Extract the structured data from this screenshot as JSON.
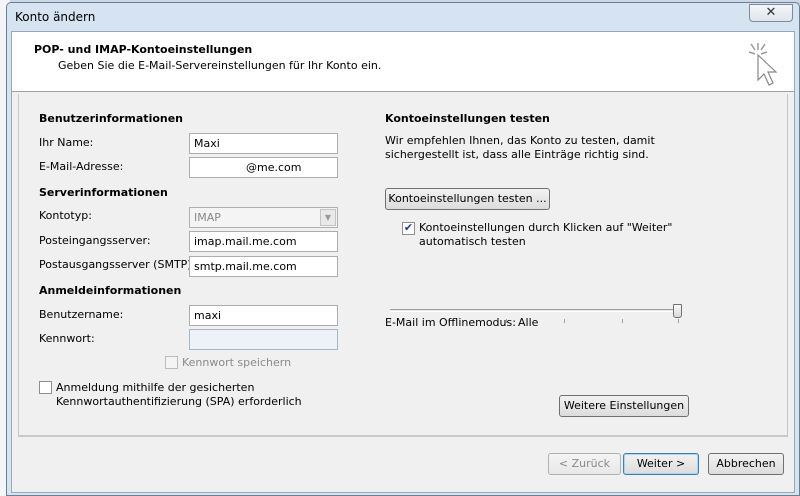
{
  "window": {
    "title": "Konto ändern",
    "close_glyph": "✕"
  },
  "header": {
    "title": "POP- und IMAP-Kontoeinstellungen",
    "subtitle": "Geben Sie die E-Mail-Servereinstellungen für Ihr Konto ein."
  },
  "user_info": {
    "section": "Benutzerinformationen",
    "name_label": "Ihr Name:",
    "name_value": "Maxi",
    "email_label": "E-Mail-Adresse:",
    "email_value": "@me.com"
  },
  "server_info": {
    "section": "Serverinformationen",
    "account_type_label": "Kontotyp:",
    "account_type_value": "IMAP",
    "incoming_label": "Posteingangsserver:",
    "incoming_value": "imap.mail.me.com",
    "outgoing_label": "Postausgangsserver (SMTP):",
    "outgoing_value": "smtp.mail.me.com"
  },
  "login_info": {
    "section": "Anmeldeinformationen",
    "username_label": "Benutzername:",
    "username_value": "maxi",
    "password_label": "Kennwort:",
    "password_value": "",
    "remember_label": "Kennwort speichern",
    "remember_checked": false
  },
  "spa": {
    "line1": "Anmeldung mithilfe der gesicherten",
    "line2": "Kennwortauthentifizierung (SPA) erforderlich",
    "checked": false
  },
  "test": {
    "section": "Kontoeinstellungen testen",
    "desc_line1": "Wir empfehlen Ihnen, das Konto zu testen, damit",
    "desc_line2": "sichergestellt ist, dass alle Einträge richtig sind.",
    "button": "Kontoeinstellungen testen ...",
    "auto_line1": "Kontoeinstellungen durch Klicken auf \"Weiter\"",
    "auto_line2": "automatisch testen",
    "auto_checked": true
  },
  "offline": {
    "label": "E-Mail im Offlinemodus:",
    "value": "Alle",
    "slider_level": 1.0
  },
  "more_settings_button": "Weitere Einstellungen",
  "footer": {
    "back": "< Zurück",
    "next": "Weiter >",
    "cancel": "Abbrechen"
  },
  "icons": {
    "close": "close-icon",
    "wizard": "wizard-cursor-icon",
    "dropdown": "chevron-down-icon",
    "check": "checkmark-icon"
  }
}
